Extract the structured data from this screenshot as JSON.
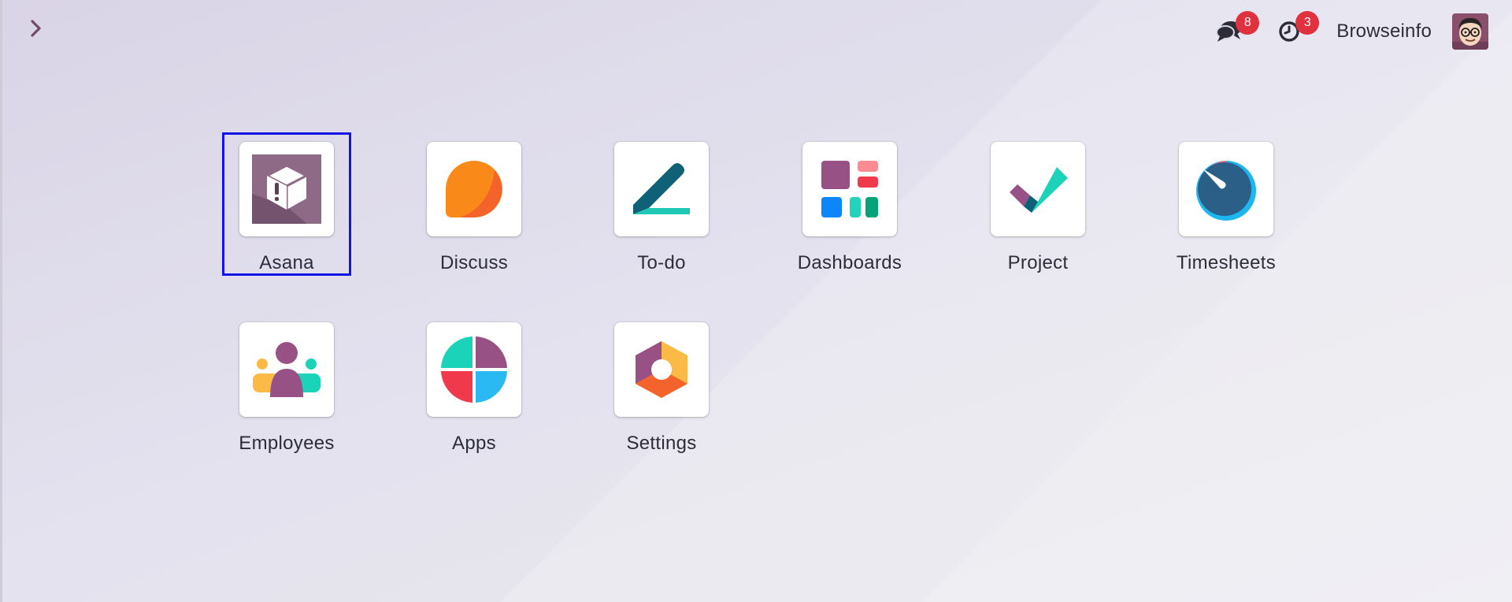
{
  "header": {
    "menu_toggle_icon": "chevron-right-icon",
    "messages": {
      "icon": "chat-bubbles-icon",
      "badge": "8"
    },
    "activities": {
      "icon": "clock-icon",
      "badge": "3"
    },
    "user": {
      "name": "Browseinfo",
      "avatar_icon": "user-avatar-icon"
    }
  },
  "apps": [
    {
      "label": "Asana",
      "icon": "asana-app-icon",
      "selected": true
    },
    {
      "label": "Discuss",
      "icon": "discuss-app-icon"
    },
    {
      "label": "To-do",
      "icon": "todo-app-icon"
    },
    {
      "label": "Dashboards",
      "icon": "dashboards-app-icon"
    },
    {
      "label": "Project",
      "icon": "project-app-icon"
    },
    {
      "label": "Timesheets",
      "icon": "timesheets-app-icon"
    },
    {
      "label": "Employees",
      "icon": "employees-app-icon"
    },
    {
      "label": "Apps",
      "icon": "apps-app-icon"
    },
    {
      "label": "Settings",
      "icon": "settings-app-icon"
    }
  ],
  "colors": {
    "selection_outline": "#1414e6",
    "badge": "#e0313f",
    "accent_purple": "#714b67"
  }
}
